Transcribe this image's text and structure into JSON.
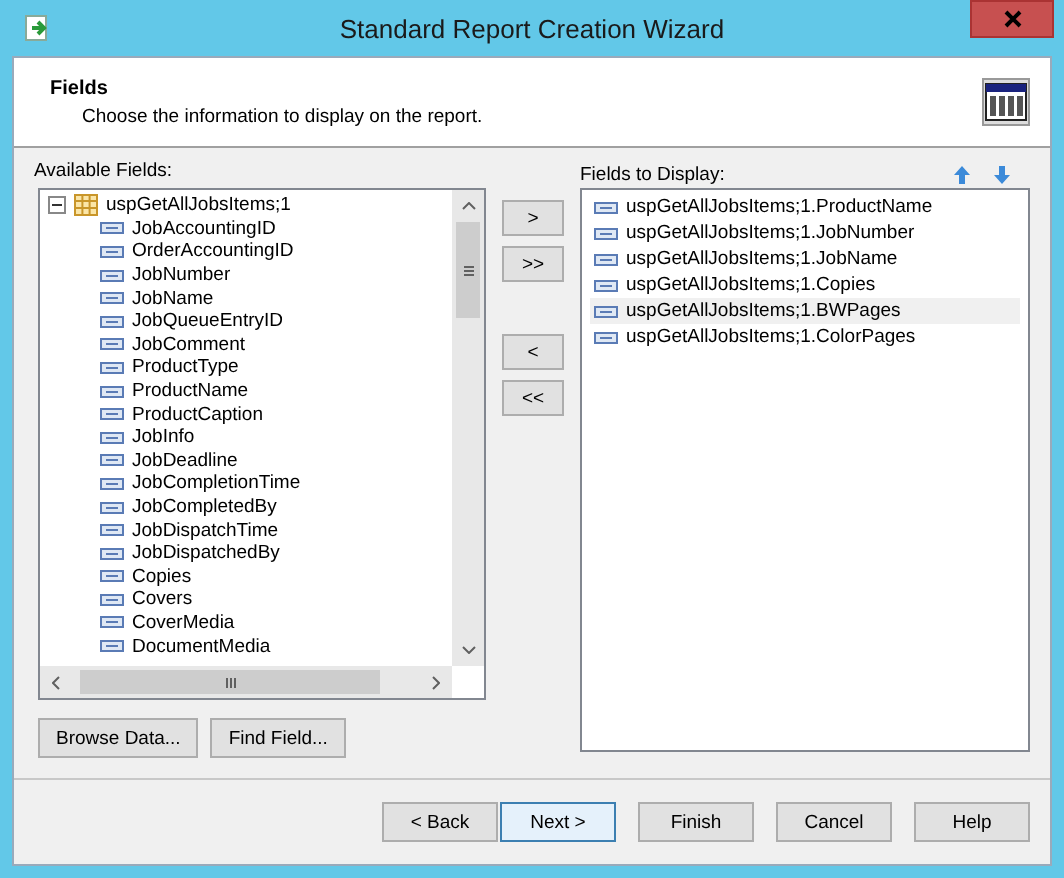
{
  "window": {
    "title": "Standard Report Creation Wizard"
  },
  "header": {
    "title": "Fields",
    "subtitle": "Choose the information to display on the report."
  },
  "available": {
    "label": "Available Fields:",
    "root": {
      "label": "uspGetAllJobsItems;1",
      "expanded": true,
      "children": [
        {
          "label": "JobAccountingID"
        },
        {
          "label": "OrderAccountingID"
        },
        {
          "label": "JobNumber"
        },
        {
          "label": "JobName"
        },
        {
          "label": "JobQueueEntryID"
        },
        {
          "label": "JobComment"
        },
        {
          "label": "ProductType"
        },
        {
          "label": "ProductName"
        },
        {
          "label": "ProductCaption"
        },
        {
          "label": "JobInfo"
        },
        {
          "label": "JobDeadline"
        },
        {
          "label": "JobCompletionTime"
        },
        {
          "label": "JobCompletedBy"
        },
        {
          "label": "JobDispatchTime"
        },
        {
          "label": "JobDispatchedBy"
        },
        {
          "label": "Copies"
        },
        {
          "label": "Covers"
        },
        {
          "label": "CoverMedia"
        },
        {
          "label": "DocumentMedia"
        }
      ]
    }
  },
  "move_buttons": [
    ">",
    ">>",
    "<",
    "<<"
  ],
  "display": {
    "label": "Fields to Display:",
    "items": [
      {
        "label": "uspGetAllJobsItems;1.ProductName",
        "selected": false
      },
      {
        "label": "uspGetAllJobsItems;1.JobNumber",
        "selected": false
      },
      {
        "label": "uspGetAllJobsItems;1.JobName",
        "selected": false
      },
      {
        "label": "uspGetAllJobsItems;1.Copies",
        "selected": false
      },
      {
        "label": "uspGetAllJobsItems;1.BWPages",
        "selected": true
      },
      {
        "label": "uspGetAllJobsItems;1.ColorPages",
        "selected": false
      }
    ]
  },
  "list_buttons": [
    "Browse Data...",
    "Find Field..."
  ],
  "footer_buttons": [
    {
      "label": "< Back",
      "default": false
    },
    {
      "label": "Next >",
      "default": true
    },
    {
      "label": "Finish",
      "default": false
    },
    {
      "label": "Cancel",
      "default": false
    },
    {
      "label": "Help",
      "default": false
    }
  ]
}
